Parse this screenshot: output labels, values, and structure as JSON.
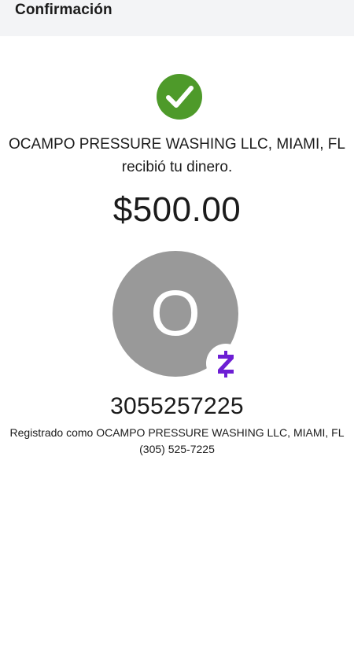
{
  "header": {
    "title": "Confirmación"
  },
  "status": {
    "icon": "check-circle-icon",
    "color": "#4e9a2a"
  },
  "recipient": {
    "name_line": "OCAMPO PRESSURE WASHING LLC, MIAMI, FL",
    "message": "recibió tu dinero."
  },
  "payment": {
    "amount": "$500.00"
  },
  "contact": {
    "avatar_initial": "O",
    "avatar_color": "#999999",
    "badge_icon": "zelle-logo-icon",
    "badge_color": "#6d1ed4",
    "phone": "3055257225",
    "registered_as": "Registrado como OCAMPO PRESSURE WASHING LLC, MIAMI, FL",
    "formatted_phone": "(305) 525-7225"
  }
}
